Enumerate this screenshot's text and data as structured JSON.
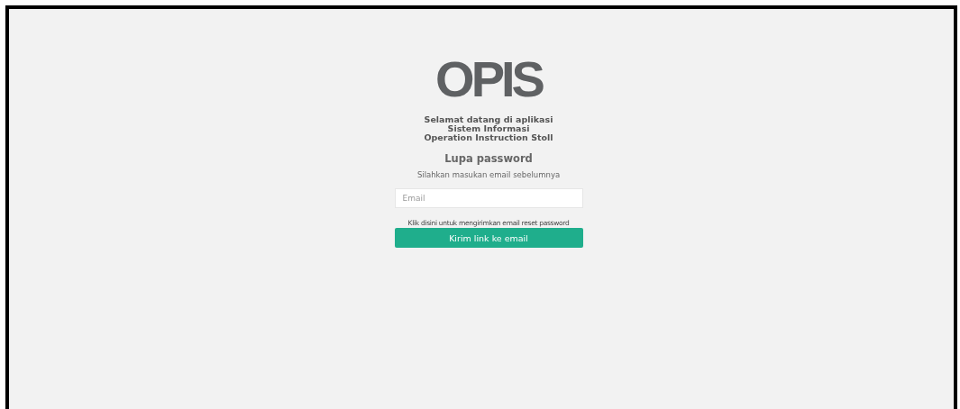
{
  "logo": "OPIS",
  "welcome": [
    "Selamat datang di aplikasi",
    "Sistem Informasi",
    "Operation Instruction Stoll"
  ],
  "heading": "Lupa password",
  "instruction": "Silahkan masukan email sebelumnya",
  "email_field": {
    "placeholder": "Email"
  },
  "hint": "Klik disini untuk mengirimkan email reset password",
  "submit_button": "Kirim link ke email"
}
